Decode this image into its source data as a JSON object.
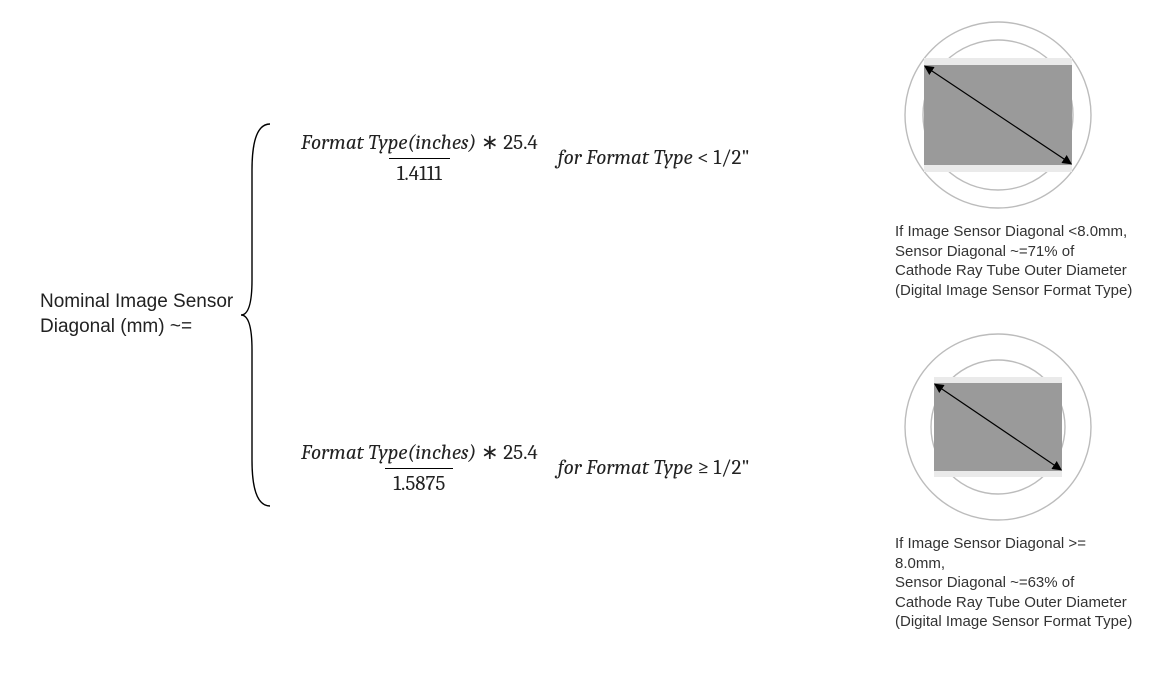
{
  "left_label_1": "Nominal Image Sensor",
  "left_label_2": "Diagonal (mm) ~=",
  "formula1": {
    "numerator_term": "Format Type",
    "numerator_unit": "(inches)",
    "numerator_mult": " ∗ 25.4",
    "denominator": "1.4111",
    "condition_prefix": " for Format Type ",
    "condition_op": "<",
    "condition_value": " 1/2\""
  },
  "formula2": {
    "numerator_term": "Format Type",
    "numerator_unit": "(inches)",
    "numerator_mult": " ∗ 25.4",
    "denominator": "1.5875",
    "condition_prefix": " for Format Type ",
    "condition_op": "≥",
    "condition_value": " 1/2\""
  },
  "diagram1": {
    "caption_l1": "If Image Sensor Diagonal <8.0mm,",
    "caption_l2": "Sensor Diagonal ~=71% of",
    "caption_l3": "Cathode Ray Tube Outer Diameter",
    "caption_l4": "(Digital Image Sensor Format Type)",
    "outer_diameter": 190,
    "inner_diameter": 150,
    "rect_w": 148,
    "rect_h": 100,
    "rect_fill": "#9a9a9a",
    "ghost_fill": "#eaeaea"
  },
  "diagram2": {
    "caption_l1": "If Image Sensor Diagonal >= 8.0mm,",
    "caption_l2": "Sensor Diagonal ~=63% of",
    "caption_l3": "Cathode Ray Tube Outer Diameter",
    "caption_l4": "(Digital Image Sensor Format Type)",
    "outer_diameter": 190,
    "inner_diameter": 134,
    "rect_w": 128,
    "rect_h": 88,
    "rect_fill": "#9a9a9a",
    "ghost_fill": "#eaeaea"
  },
  "chart_data": {
    "type": "table",
    "title": "Nominal Image Sensor Diagonal (mm) ≈ piecewise formula",
    "cases": [
      {
        "condition": "Format Type < 1/2 inch",
        "formula": "Format Type (in) × 25.4 / 1.4111",
        "sensor_diag_pct_of_crt_outer_diam": 71
      },
      {
        "condition": "Format Type ≥ 1/2 inch",
        "formula": "Format Type (in) × 25.4 / 1.5875",
        "sensor_diag_pct_of_crt_outer_diam": 63
      }
    ],
    "threshold_mm": 8.0,
    "inches_to_mm": 25.4
  }
}
